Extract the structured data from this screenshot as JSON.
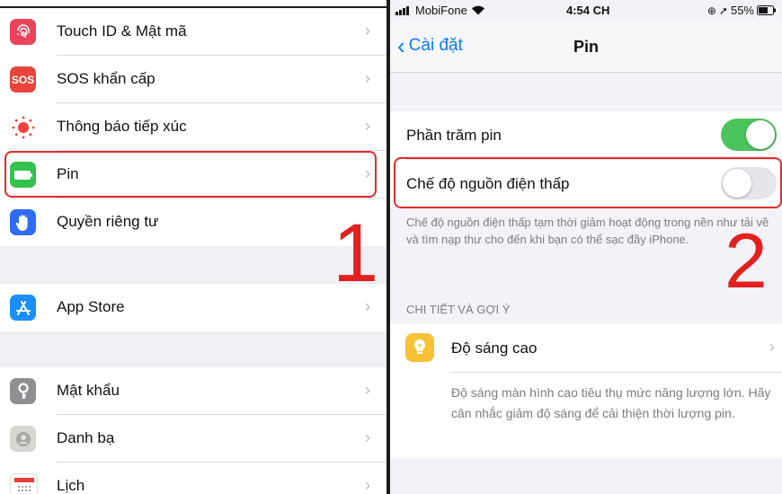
{
  "left_settings": {
    "items": [
      {
        "label": "Touch ID & Mật mã",
        "icon": "fingerprint-icon",
        "color": "#e9445a"
      },
      {
        "label": "SOS khẩn cấp",
        "icon": "sos-icon",
        "icon_text": "SOS",
        "color": "#e8453c"
      },
      {
        "label": "Thông báo tiếp xúc",
        "icon": "exposure-notification-icon",
        "color": "#ffffff"
      },
      {
        "label": "Pin",
        "icon": "battery-icon",
        "color": "#33c24d"
      },
      {
        "label": "Quyền riêng tư",
        "icon": "hand-icon",
        "color": "#2f6cf5"
      },
      {
        "label": "App Store",
        "icon": "app-store-icon",
        "color": "#1c8ef9"
      },
      {
        "label": "Mật khẩu",
        "icon": "key-icon",
        "color": "#8e8e93"
      },
      {
        "label": "Danh bạ",
        "icon": "contacts-icon",
        "color": "#d8d6d0"
      },
      {
        "label": "Lịch",
        "icon": "calendar-icon",
        "color": "#ffffff"
      }
    ],
    "annotation_number": "1"
  },
  "status_bar": {
    "carrier": "MobiFone",
    "time": "4:54 CH",
    "battery": "55%"
  },
  "battery_screen": {
    "back_label": "Cài đặt",
    "title": "Pin",
    "battery_percentage_label": "Phần trăm pin",
    "battery_percentage_on": true,
    "low_power_label": "Chế độ nguồn điện thấp",
    "low_power_on": false,
    "low_power_note": "Chế độ nguồn điện thấp tạm thời giảm hoạt động trong nền như tải về và tìm nạp thư cho đến khi bạn có thể sạc đầy iPhone.",
    "section_header": "CHI TIẾT VÀ GỢI Ý",
    "suggestion_title": "Độ sáng cao",
    "suggestion_note": "Độ sáng màn hình cao tiêu thụ mức năng lượng lớn. Hãy cân nhắc giảm độ sáng để cải thiện thời lượng pin.",
    "annotation_number": "2"
  },
  "colors": {
    "toggle_on": "#4cc45d",
    "toggle_off": "#e5e5ea",
    "highlight": "#e32b2b",
    "link_blue": "#0a7aff"
  }
}
